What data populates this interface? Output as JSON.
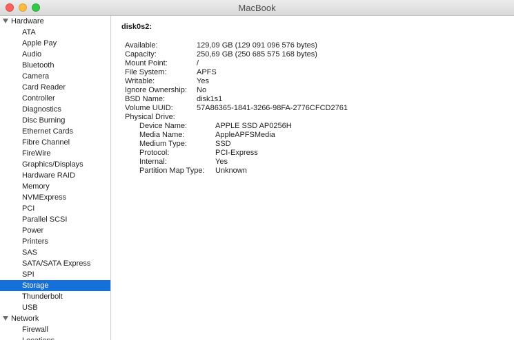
{
  "window": {
    "title": "MacBook"
  },
  "sidebar": {
    "items": [
      {
        "label": "Hardware",
        "group": true
      },
      {
        "label": "ATA"
      },
      {
        "label": "Apple Pay"
      },
      {
        "label": "Audio"
      },
      {
        "label": "Bluetooth"
      },
      {
        "label": "Camera"
      },
      {
        "label": "Card Reader"
      },
      {
        "label": "Controller"
      },
      {
        "label": "Diagnostics"
      },
      {
        "label": "Disc Burning"
      },
      {
        "label": "Ethernet Cards"
      },
      {
        "label": "Fibre Channel"
      },
      {
        "label": "FireWire"
      },
      {
        "label": "Graphics/Displays"
      },
      {
        "label": "Hardware RAID"
      },
      {
        "label": "Memory"
      },
      {
        "label": "NVMExpress"
      },
      {
        "label": "PCI"
      },
      {
        "label": "Parallel SCSI"
      },
      {
        "label": "Power"
      },
      {
        "label": "Printers"
      },
      {
        "label": "SAS"
      },
      {
        "label": "SATA/SATA Express"
      },
      {
        "label": "SPI"
      },
      {
        "label": "Storage",
        "selected": true
      },
      {
        "label": "Thunderbolt"
      },
      {
        "label": "USB"
      },
      {
        "label": "Network",
        "group": true
      },
      {
        "label": "Firewall"
      },
      {
        "label": "Locations"
      }
    ]
  },
  "detail": {
    "heading": "disk0s2:",
    "fields": [
      {
        "label": "Available:",
        "value": "129,09 GB (129 091 096 576 bytes)"
      },
      {
        "label": "Capacity:",
        "value": "250,69 GB (250 685 575 168 bytes)"
      },
      {
        "label": "Mount Point:",
        "value": "/"
      },
      {
        "label": "File System:",
        "value": "APFS"
      },
      {
        "label": "Writable:",
        "value": "Yes"
      },
      {
        "label": "Ignore Ownership:",
        "value": "No"
      },
      {
        "label": "BSD Name:",
        "value": "disk1s1"
      },
      {
        "label": "Volume UUID:",
        "value": "57A86365-1841-3266-98FA-2776CFCD2761"
      },
      {
        "label": "Physical Drive:",
        "value": ""
      }
    ],
    "physical_drive": [
      {
        "label": "Device Name:",
        "value": "APPLE SSD AP0256H"
      },
      {
        "label": "Media Name:",
        "value": "AppleAPFSMedia"
      },
      {
        "label": "Medium Type:",
        "value": "SSD"
      },
      {
        "label": "Protocol:",
        "value": "PCI-Express"
      },
      {
        "label": "Internal:",
        "value": "Yes"
      },
      {
        "label": "Partition Map Type:",
        "value": "Unknown"
      }
    ]
  }
}
